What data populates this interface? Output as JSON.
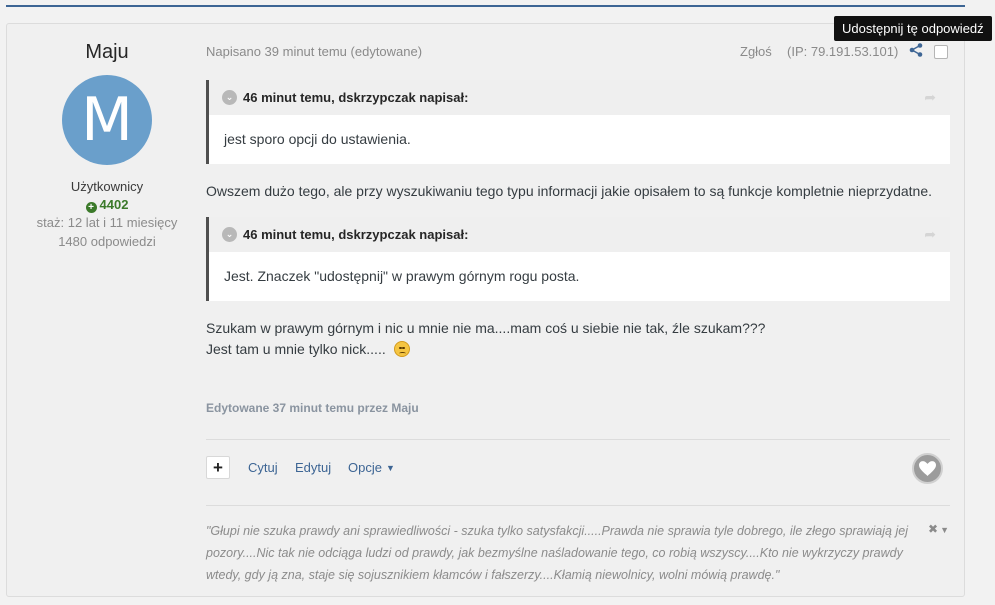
{
  "author": {
    "name": "Maju",
    "avatar_letter": "M",
    "group": "Użytkownicy",
    "reputation": "4402",
    "membership": "staż: 12 lat i 11 miesięcy",
    "posts": "1480 odpowiedzi"
  },
  "post_meta": {
    "posted": "Napisano 39 minut temu (edytowane)",
    "report": "Zgłoś",
    "ip": "(IP: 79.191.53.101)",
    "share_tooltip": "Udostępnij tę odpowiedź"
  },
  "quotes": [
    {
      "header": "46 minut temu, dskrzypczak napisał:",
      "body": "jest sporo opcji do ustawienia."
    },
    {
      "header": "46 minut temu, dskrzypczak napisał:",
      "body": "Jest. Znaczek \"udostępnij\" w prawym górnym rogu posta."
    }
  ],
  "content": {
    "para1": "Owszem dużo tego, ale przy wyszukiwaniu tego typu informacji jakie opisałem to są funkcje kompletnie nieprzydatne.",
    "para2_line1": "Szukam w prawym górnym i nic u mnie nie ma....mam coś u siebie nie tak, źle szukam???",
    "para2_line2": "Jest tam u mnie tylko nick....."
  },
  "edited_note": "Edytowane 37 minut temu przez Maju",
  "actions": {
    "plus": "+",
    "quote": "Cytuj",
    "edit": "Edytuj",
    "options": "Opcje"
  },
  "signature": "\"Głupi nie szuka prawdy ani sprawiedliwości - szuka tylko satysfakcji.....Prawda nie sprawia tyle dobrego, ile złego sprawiają jej pozory....Nic tak nie odciąga ludzi od prawdy, jak bezmyślne naśladowanie tego, co robią wszyscy....Kto nie wykrzyczy prawdy wtedy, gdy ją zna, staje się sojusznikiem kłamców i fałszerzy....Kłamią niewolnicy, wolni mówią prawdę.\"",
  "colors": {
    "link": "#3d6594",
    "avatar": "#6a9fcb",
    "reputation": "#3b7a2a"
  }
}
